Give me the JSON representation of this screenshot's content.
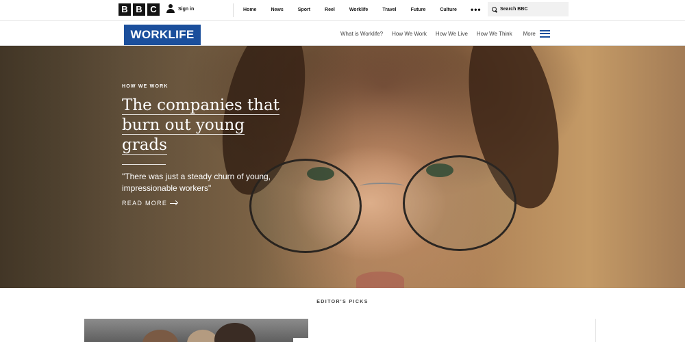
{
  "bbc_bar": {
    "logo_letters": [
      "B",
      "B",
      "C"
    ],
    "signin_label": "Sign in",
    "nav_items": [
      "Home",
      "News",
      "Sport",
      "Reel",
      "Worklife",
      "Travel",
      "Future",
      "Culture"
    ],
    "more_label": "•••",
    "search_placeholder": "Search BBC"
  },
  "worklife_bar": {
    "logo_text": "WORKLIFE",
    "nav_items": [
      "What is Worklife?",
      "How We Work",
      "How We Live",
      "How We Think"
    ],
    "more_label": "More",
    "accent_color": "#1b4f9c"
  },
  "hero": {
    "kicker": "HOW WE WORK",
    "headline_lines": [
      "The companies that",
      "burn out young",
      "grads"
    ],
    "quote": "\"There was just a steady churn of young, impressionable workers\"",
    "read_more": "READ MORE"
  },
  "editors_picks": {
    "label": "EDITOR'S PICKS"
  }
}
